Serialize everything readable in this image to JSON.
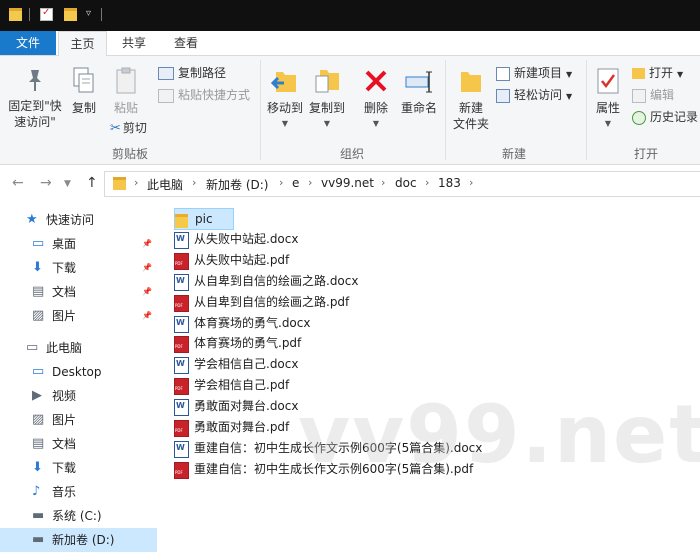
{
  "ribbon_tabs": [
    "文件",
    "主页",
    "共享",
    "查看"
  ],
  "ribbon": {
    "clipboard": {
      "pin_label_line1": "固定到\"快",
      "pin_label_line2": "速访问\"",
      "copy": "复制",
      "paste": "粘贴",
      "copy_path": "复制路径",
      "paste_shortcut": "粘贴快捷方式",
      "cut": "剪切",
      "group": "剪贴板"
    },
    "organize": {
      "move_to": "移动到",
      "copy_to": "复制到",
      "delete": "删除",
      "rename": "重命名",
      "group": "组织"
    },
    "new": {
      "new_folder_line1": "新建",
      "new_folder_line2": "文件夹",
      "new_item": "新建项目",
      "easy_access": "轻松访问",
      "group": "新建"
    },
    "open": {
      "properties": "属性",
      "open": "打开",
      "edit": "编辑",
      "history": "历史记录",
      "group": "打开"
    }
  },
  "breadcrumb": [
    "此电脑",
    "新加卷 (D:)",
    "e",
    "vv99.net",
    "doc",
    "183"
  ],
  "nav": [
    {
      "label": "快速访问",
      "icon": "star-icon",
      "indent": 1,
      "pinned": false
    },
    {
      "label": "桌面",
      "icon": "desktop-icon",
      "indent": 2,
      "pinned": true
    },
    {
      "label": "下载",
      "icon": "download-icon",
      "indent": 2,
      "pinned": true
    },
    {
      "label": "文档",
      "icon": "document-icon",
      "indent": 2,
      "pinned": true
    },
    {
      "label": "图片",
      "icon": "picture-icon",
      "indent": 2,
      "pinned": true
    },
    {
      "label": "此电脑",
      "icon": "computer-icon",
      "indent": 1,
      "pinned": false
    },
    {
      "label": "Desktop",
      "icon": "desktop-icon",
      "indent": 2,
      "pinned": false
    },
    {
      "label": "视频",
      "icon": "video-icon",
      "indent": 2,
      "pinned": false
    },
    {
      "label": "图片",
      "icon": "picture-icon",
      "indent": 2,
      "pinned": false
    },
    {
      "label": "文档",
      "icon": "document-icon",
      "indent": 2,
      "pinned": false
    },
    {
      "label": "下载",
      "icon": "download-icon",
      "indent": 2,
      "pinned": false
    },
    {
      "label": "音乐",
      "icon": "music-icon",
      "indent": 2,
      "pinned": false
    },
    {
      "label": "系统 (C:)",
      "icon": "drive-icon",
      "indent": 2,
      "pinned": false
    },
    {
      "label": "新加卷 (D:)",
      "icon": "drive-icon",
      "indent": 2,
      "pinned": false
    }
  ],
  "files": [
    {
      "name": "pic",
      "type": "folder"
    },
    {
      "name": "从失败中站起.docx",
      "type": "word"
    },
    {
      "name": "从失败中站起.pdf",
      "type": "pdf"
    },
    {
      "name": "从自卑到自信的绘画之路.docx",
      "type": "word"
    },
    {
      "name": "从自卑到自信的绘画之路.pdf",
      "type": "pdf"
    },
    {
      "name": "体育赛场的勇气.docx",
      "type": "word"
    },
    {
      "name": "体育赛场的勇气.pdf",
      "type": "pdf"
    },
    {
      "name": "学会相信自己.docx",
      "type": "word"
    },
    {
      "name": "学会相信自己.pdf",
      "type": "pdf"
    },
    {
      "name": "勇敢面对舞台.docx",
      "type": "word"
    },
    {
      "name": "勇敢面对舞台.pdf",
      "type": "pdf"
    },
    {
      "name": "重建自信：初中生成长作文示例600字(5篇合集).docx",
      "type": "word"
    },
    {
      "name": "重建自信：初中生成长作文示例600字(5篇合集).pdf",
      "type": "pdf"
    }
  ],
  "watermark": "vv99.net",
  "colors": {
    "accent": "#1979ca",
    "selection": "#cce8ff",
    "delete_red": "#e81123"
  }
}
